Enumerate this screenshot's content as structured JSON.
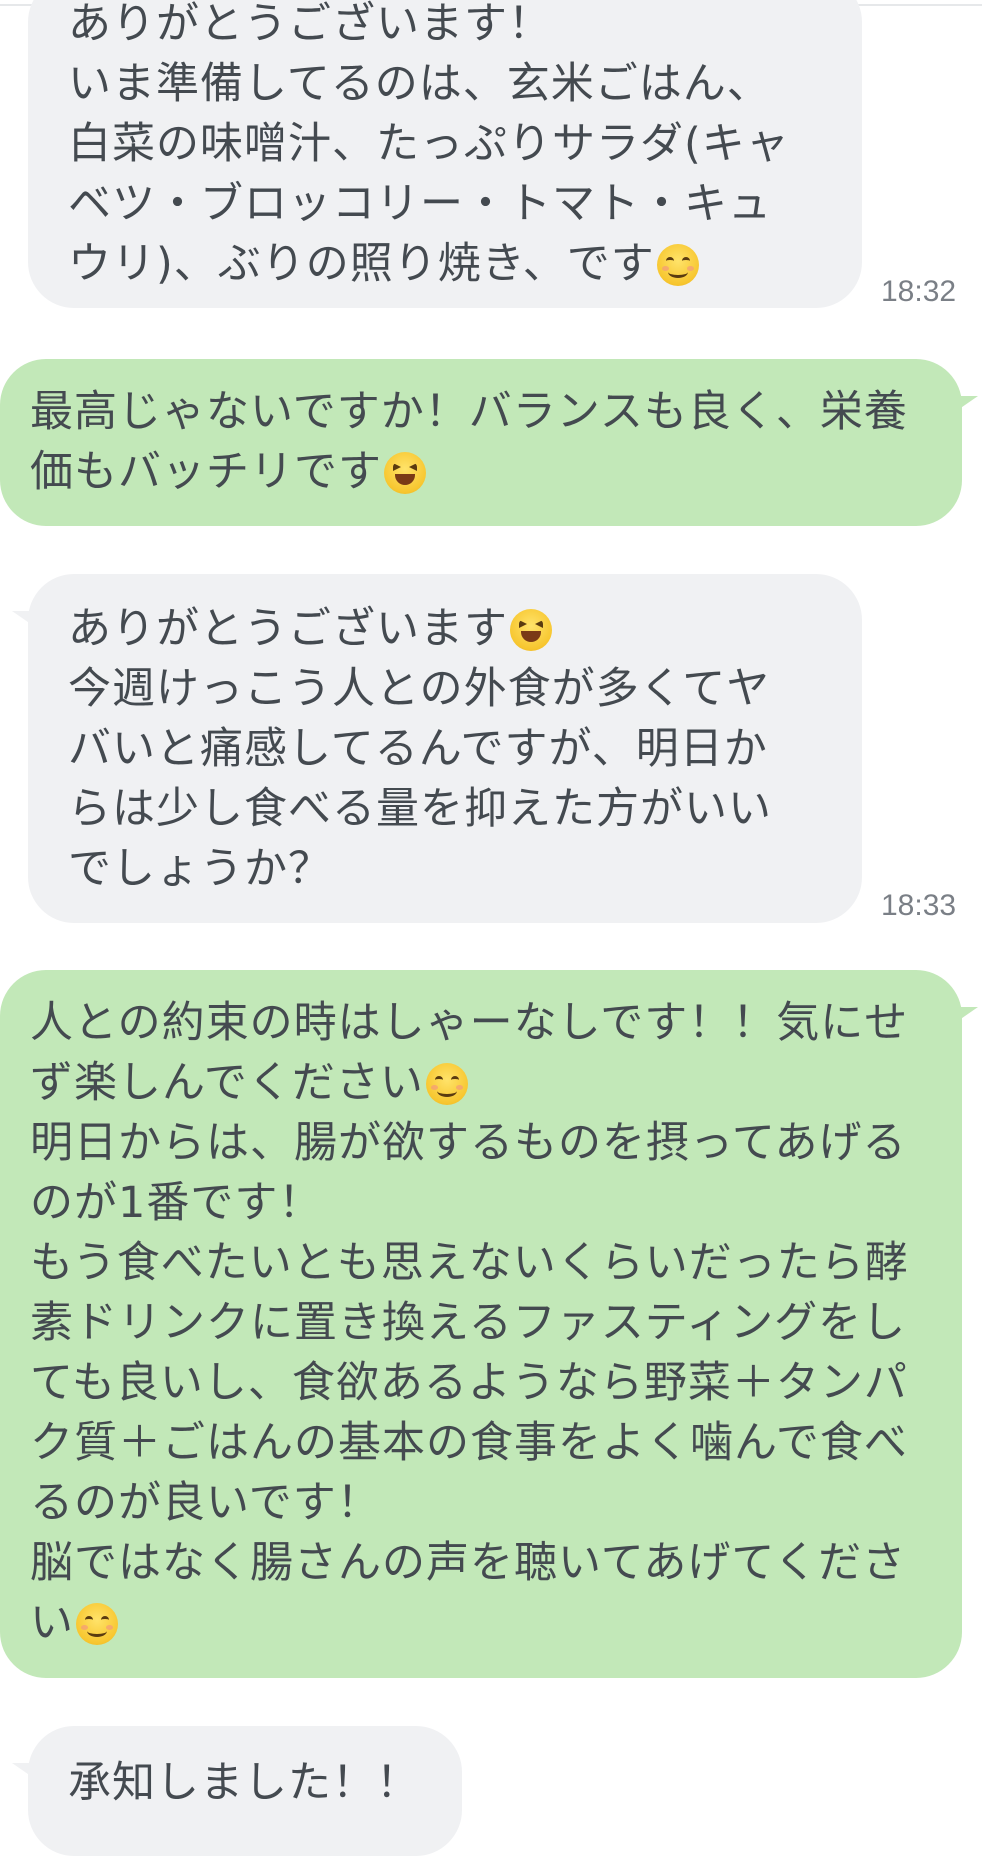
{
  "chat": {
    "messages": [
      {
        "side": "in",
        "lines": [
          "ありがとうございます！",
          "いま準備してるのは、玄米ごはん、",
          "白菜の味噌汁、たっぷりサラダ(キャ",
          "ベツ・ブロッコリー・トマト・キュ",
          "ウリ)、ぶりの照り焼き、です"
        ],
        "emoji": "smiling-face-icon",
        "time": "18:32"
      },
      {
        "side": "out",
        "lines": [
          "最高じゃないですか！バランスも良く、栄養",
          "価もバッチリです"
        ],
        "emoji": "laughing-face-icon"
      },
      {
        "side": "in",
        "lines": [
          "ありがとうございます",
          "今週けっこう人との外食が多くてヤ",
          "バいと痛感してるんですが、明日か",
          "らは少し食べる量を抑えた方がいい",
          "でしょうか？"
        ],
        "emoji": "laughing-face-icon",
        "time": "18:33"
      },
      {
        "side": "out",
        "lines": [
          "人との約束の時はしゃーなしです！！気にせ",
          "ず楽しんでください",
          "明日からは、腸が欲するものを摂ってあげる",
          "のが1番です！",
          "もう食べたいとも思えないくらいだったら酵",
          "素ドリンクに置き換えるファスティングをし",
          "ても良いし、食欲あるようなら野菜＋タンパ",
          "ク質＋ごはんの基本の食事をよく噛んで食べ",
          "るのが良いです！",
          "脳ではなく腸さんの声を聴いてあげてくださ",
          "い"
        ]
      },
      {
        "side": "in",
        "lines": [
          "承知しました！！"
        ]
      }
    ]
  }
}
